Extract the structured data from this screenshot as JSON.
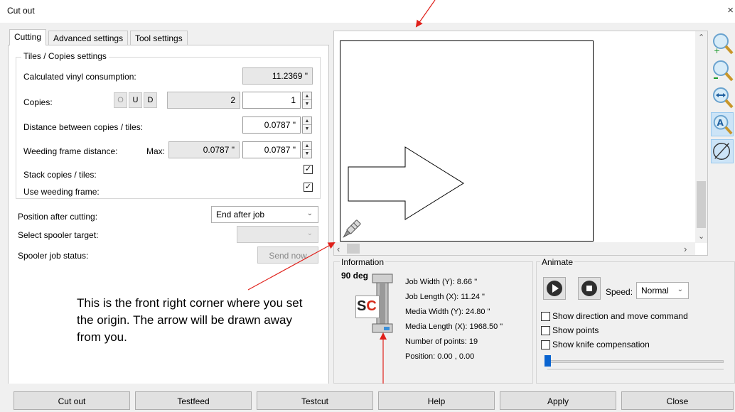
{
  "window": {
    "title": "Cut out",
    "close_glyph": "×"
  },
  "tabs": [
    {
      "label": "Cutting",
      "active": true
    },
    {
      "label": "Advanced settings",
      "active": false
    },
    {
      "label": "Tool settings",
      "active": false
    }
  ],
  "tiles_group": {
    "title": "Tiles / Copies settings",
    "vinyl_label": "Calculated vinyl consumption:",
    "vinyl_value": "11.2369 \"",
    "copies_label": "Copies:",
    "copies_buttons": [
      "O",
      "U",
      "D"
    ],
    "copies_total": "2",
    "copies_value": "1",
    "distance_label": "Distance between copies / tiles:",
    "distance_value": "0.0787 \"",
    "weeding_label": "Weeding frame distance:",
    "weeding_max_label": "Max:",
    "weeding_max_value": "0.0787 \"",
    "weeding_value": "0.0787 \"",
    "stack_label": "Stack copies / tiles:",
    "stack_checked": true,
    "use_weeding_label": "Use weeding frame:",
    "use_weeding_checked": true,
    "check_glyph": "✓"
  },
  "position_label": "Position after cutting:",
  "position_value": "End after job",
  "spooler_target_label": "Select spooler target:",
  "spooler_target_value": "",
  "spooler_status_label": "Spooler job status:",
  "send_now_label": "Send now",
  "annotation_note": "This is the front right corner where you set the origin. The arrow will be drawn away from you.",
  "information": {
    "title": "Information",
    "rotation": "90 deg",
    "logo_text": "SC",
    "job_width": "Job Width (Y): 8.66 \"",
    "job_length": "Job Length (X): 11.24 \"",
    "media_width": "Media Width (Y): 24.80 \"",
    "media_length": "Media Length (X): 1968.50 \"",
    "points": "Number of points: 19",
    "position": "Position: 0.00 , 0.00"
  },
  "animate": {
    "title": "Animate",
    "speed_label": "Speed:",
    "speed_value": "Normal",
    "show_direction": "Show direction and move command",
    "show_points": "Show points",
    "show_knife": "Show knife compensation",
    "slider_level": 0.0
  },
  "zoom_tools": [
    "zoom-in-icon",
    "zoom-out-icon",
    "zoom-fit-width-icon",
    "zoom-auto-icon",
    "no-zoom-icon"
  ],
  "buttons": {
    "cut_out": "Cut out",
    "testfeed": "Testfeed",
    "testcut": "Testcut",
    "help": "Help",
    "apply": "Apply",
    "close": "Close"
  },
  "colors": {
    "annotation_red": "#e0201a",
    "accent_blue": "#0a64d0"
  }
}
